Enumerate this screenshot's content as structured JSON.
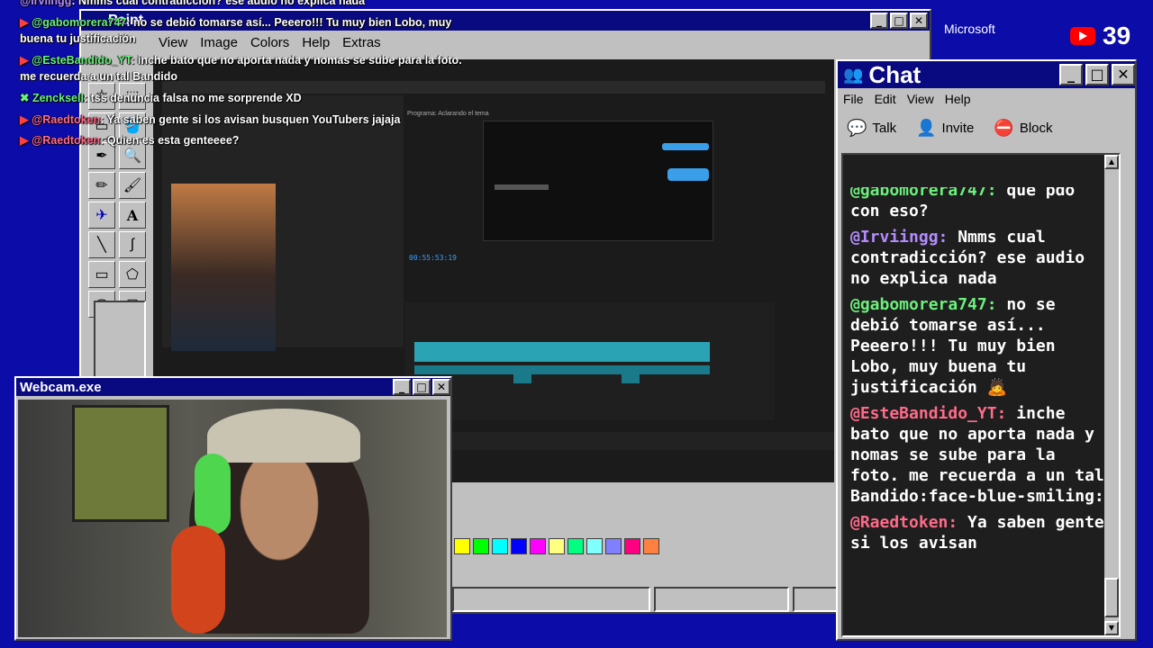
{
  "overlay_chat": [
    {
      "user": "@Irviingg",
      "text": ": Nmms cual contradicción? ese audio no explica nada",
      "color": "#b48cff"
    },
    {
      "user": "@gabomorera747",
      "text": ": no se debió tomarse así... Peeero!!! Tu muy bien Lobo, muy",
      "color": "#6cf07c"
    },
    {
      "user": "",
      "text": "buena tu justificación",
      "color": "#ffffff"
    },
    {
      "user": "@EsteBandido_YT",
      "text": ": inche bato que no aporta nada y nomas se sube para la foto.",
      "color": "#6cf07c"
    },
    {
      "user": "",
      "text": "me recuerda a un tal Bandido",
      "color": "#ffffff"
    },
    {
      "user": "Zencksell",
      "text": ": tss denuncia falsa no me sorprende XD",
      "color": "#6cf07c"
    },
    {
      "user": "@Raedtoken",
      "text": ": Ya saben gente si los avisan busquen YouTubers jajaja",
      "color": "#ff6b8a"
    },
    {
      "user": "@Raedtoken",
      "text": ": Quien es esta genteeee?",
      "color": "#ff6b8a"
    }
  ],
  "paint": {
    "title": "Paint",
    "menu": [
      "View",
      "Image",
      "Colors",
      "Help",
      "Extras"
    ],
    "palette": [
      "#ffff00",
      "#00ff00",
      "#00ffff",
      "#0000ff",
      "#ff00ff",
      "#ffff80",
      "#00ff80",
      "#80ffff",
      "#8080ff",
      "#ff0080",
      "#ff8040"
    ]
  },
  "editor": {
    "timecode": "00:55:53:19",
    "panel_label": "Programa: Aclarando el tema"
  },
  "webcam": {
    "title": "Webcam.exe"
  },
  "top_right": {
    "brand": "Microsoft",
    "viewers": "39"
  },
  "chat": {
    "title": "Chat",
    "menu": [
      "File",
      "Edit",
      "View",
      "Help"
    ],
    "toolbar": {
      "talk": "Talk",
      "invite": "Invite",
      "block": "Block"
    },
    "messages": [
      {
        "user": "@gabomorera747:",
        "text": " que pdo con eso?",
        "color": "#6cf07c"
      },
      {
        "user": "@Irviingg:",
        "text": " Nmms cual contradicción? ese audio no explica nada",
        "color": "#b48cff"
      },
      {
        "user": "@gabomorera747:",
        "text": " no se debió tomarse así... Peeero!!! Tu muy bien Lobo, muy buena tu justificación 🙇",
        "color": "#6cf07c"
      },
      {
        "user": "@EsteBandido_YT:",
        "text": " inche bato que no aporta nada y nomas se sube para la foto. me recuerda a un tal Bandido:face-blue-smiling:",
        "color": "#ff6b8a"
      },
      {
        "user": "@Raedtoken:",
        "text": " Ya saben gente si los avisan",
        "color": "#ff6b8a"
      }
    ]
  }
}
